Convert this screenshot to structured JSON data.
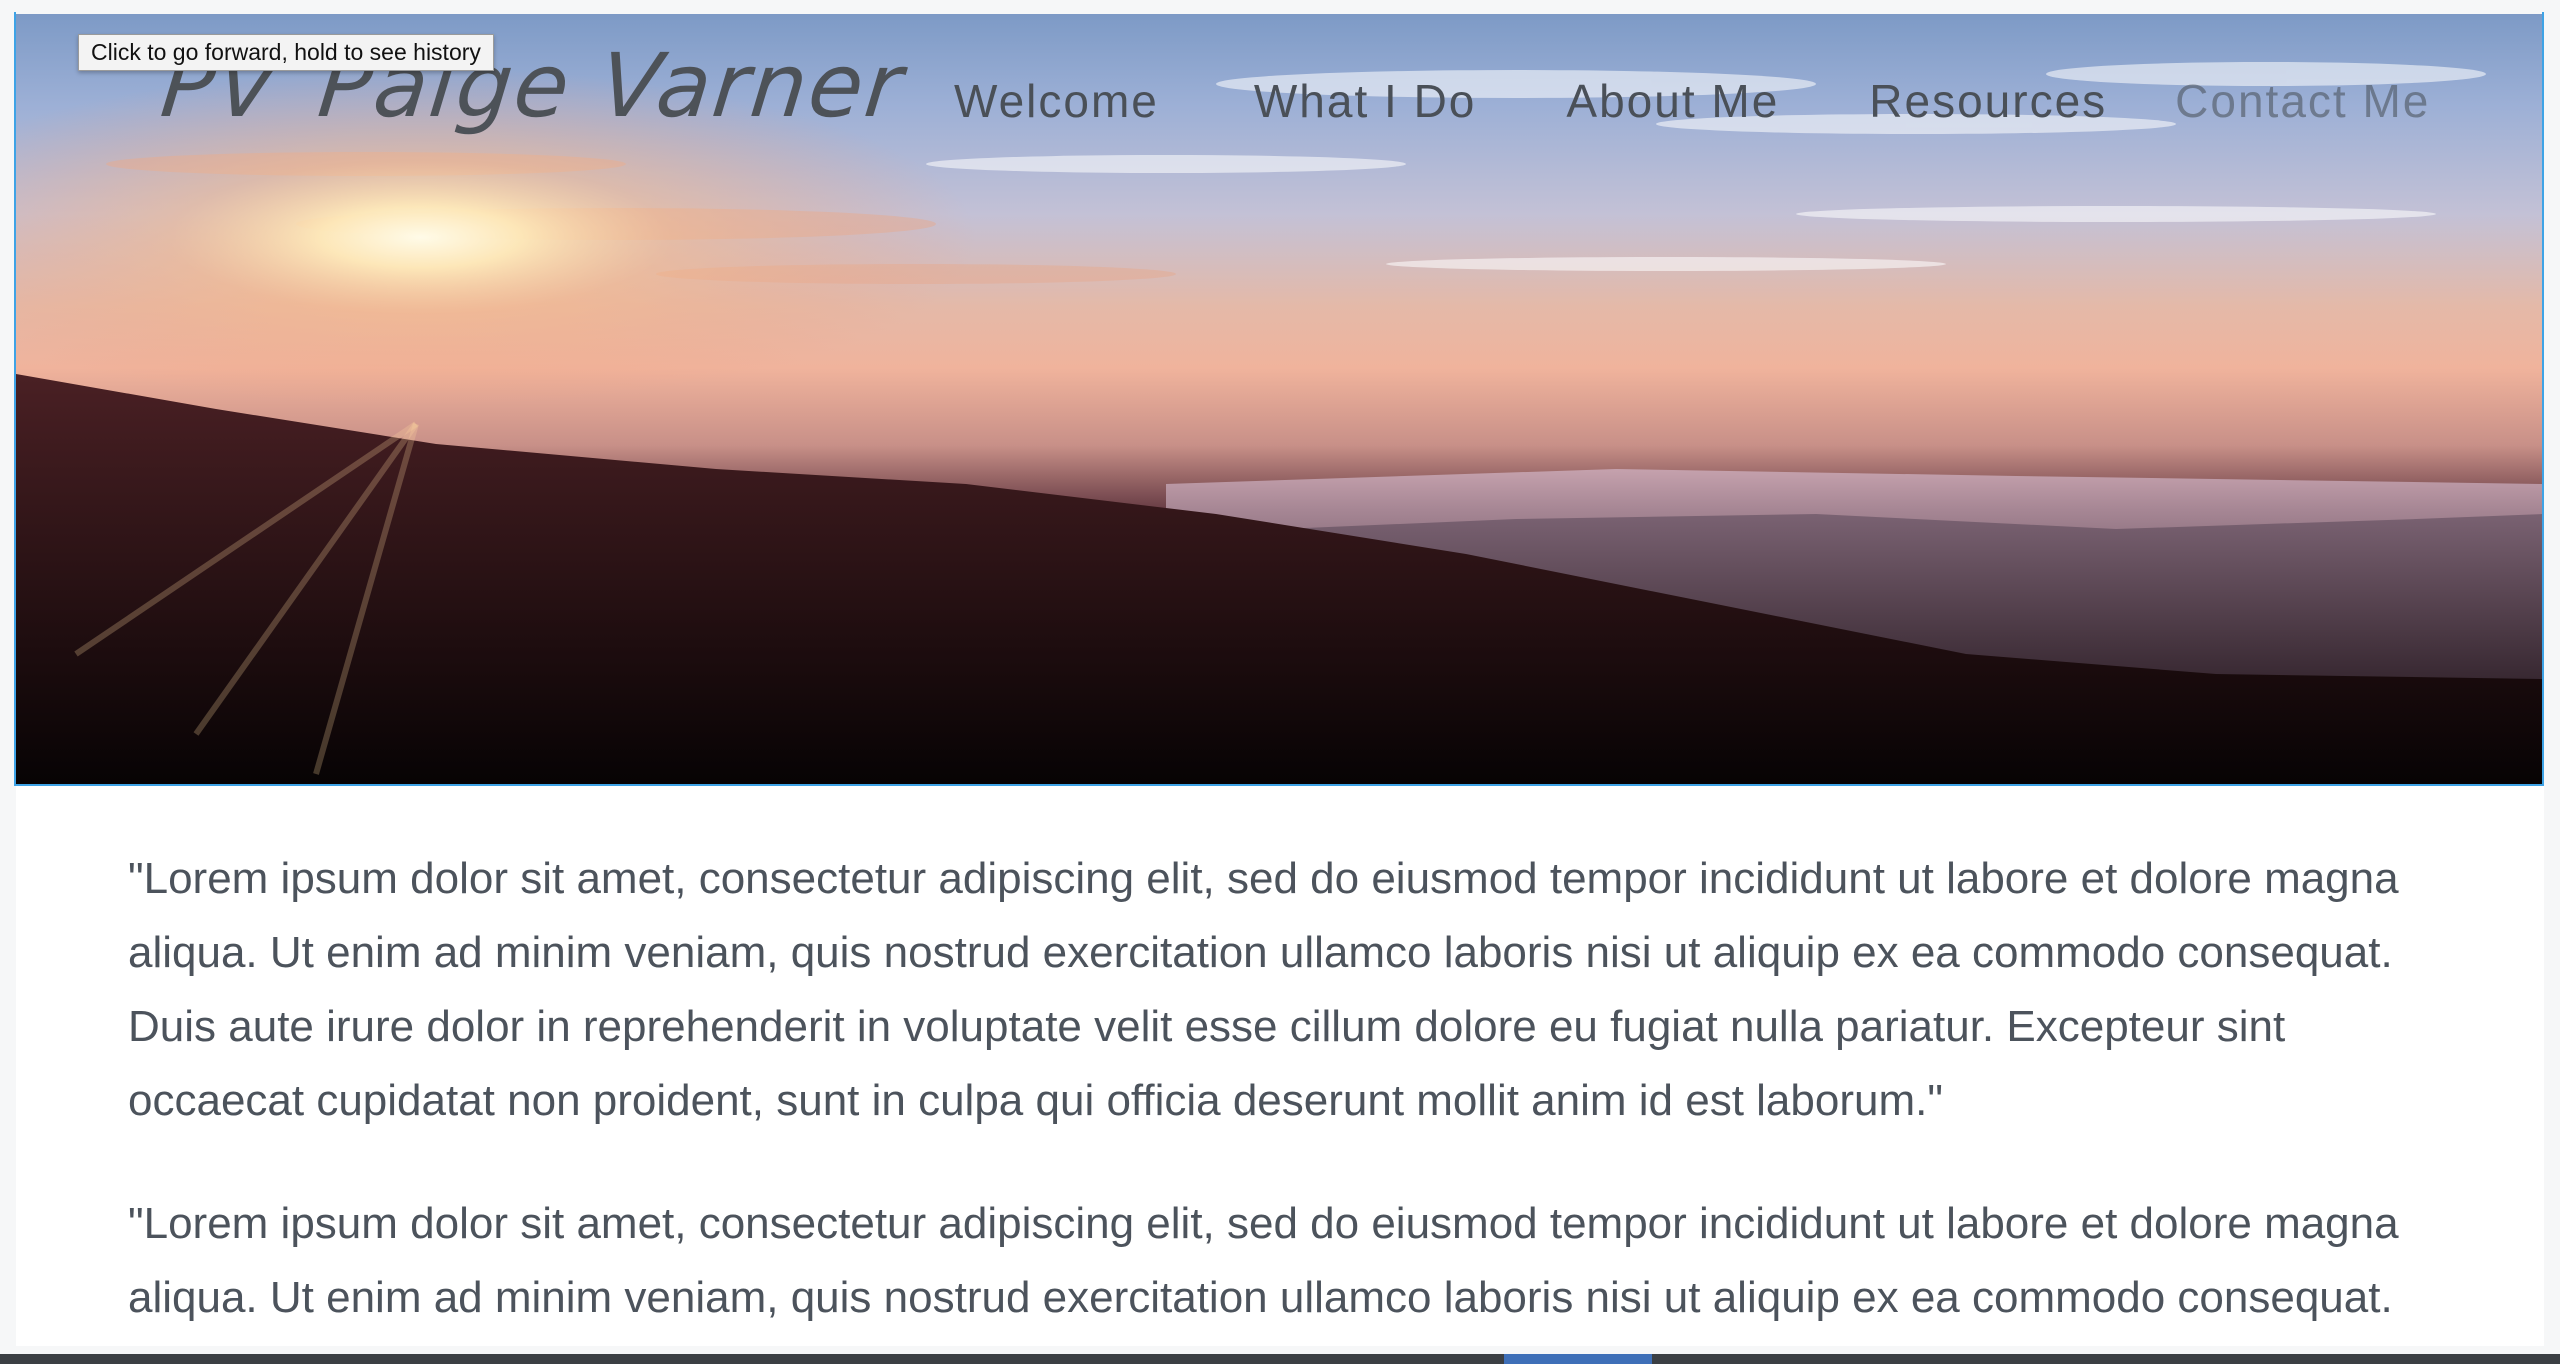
{
  "tooltip": {
    "text": "Click to go forward, hold to see history"
  },
  "logo": {
    "monogram": "PV",
    "name": "Paige Varner"
  },
  "nav": {
    "items": [
      {
        "label": "Welcome"
      },
      {
        "label": "What I Do"
      },
      {
        "label": "About Me"
      },
      {
        "label": "Resources"
      },
      {
        "label": "Contact Me"
      }
    ]
  },
  "hero": {
    "icon": "sunset-mountains-image"
  },
  "content": {
    "paragraphs": [
      "\"Lorem ipsum dolor sit amet, consectetur adipiscing elit, sed do eiusmod tempor incididunt ut labore et dolore magna aliqua. Ut enim ad minim veniam, quis nostrud exercitation ullamco laboris nisi ut aliquip ex ea commodo consequat. Duis aute irure dolor in reprehenderit in voluptate velit esse cillum dolore eu fugiat nulla pariatur. Excepteur sint occaecat cupidatat non proident, sunt in culpa qui officia deserunt mollit anim id est laborum.\"",
      "\"Lorem ipsum dolor sit amet, consectetur adipiscing elit, sed do eiusmod tempor incididunt ut labore et dolore magna aliqua. Ut enim ad minim veniam, quis nostrud exercitation ullamco laboris nisi ut aliquip ex ea commodo consequat."
    ]
  },
  "colors": {
    "nav_text": "#4a5058",
    "body_text": "#4c535c",
    "frame_accent": "#3ea3e6"
  }
}
